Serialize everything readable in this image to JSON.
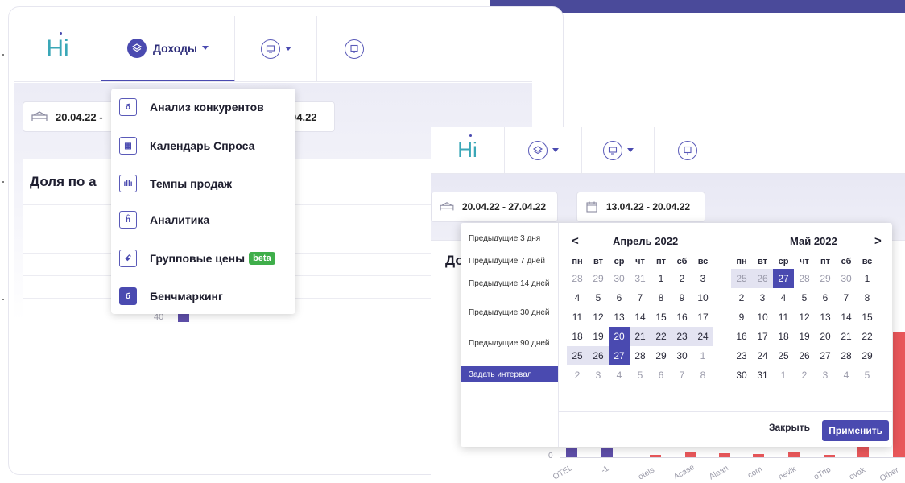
{
  "colors": {
    "accent": "#4a4ab0",
    "brand_teal": "#3aa7b7",
    "bar_purple": "#5e4ea8",
    "bar_red": "#e8575a",
    "beta_green": "#3fae4a"
  },
  "logo": {
    "text": "Hi"
  },
  "left_screen": {
    "nav": {
      "revenue_label": "Доходы"
    },
    "date_range": "20.04.22 -",
    "compare_range_tail": "04.22",
    "card_title": "Доля по а",
    "axis_tick": "40",
    "menu": [
      {
        "label": "Анализ конкурентов",
        "icon": "building-icon",
        "icon_glyph": "б",
        "filled": false
      },
      {
        "label": "Календарь Спроса",
        "icon": "calendar-grid-icon",
        "icon_glyph": "▦",
        "filled": false
      },
      {
        "label": "Темпы продаж",
        "icon": "bar-chart-icon",
        "icon_glyph": "ıllı",
        "filled": false
      },
      {
        "label": "Аналитика",
        "icon": "house-icon",
        "icon_glyph": "ĥ",
        "filled": false
      },
      {
        "label": "Групповые цены",
        "icon": "people-icon",
        "icon_glyph": "ꗃ",
        "filled": false,
        "badge": "beta"
      },
      {
        "label": "Бенчмаркинг",
        "icon": "building-icon",
        "icon_glyph": "б",
        "filled": true
      }
    ]
  },
  "right_screen": {
    "date_range": "20.04.22 - 27.04.22",
    "compare_range": "13.04.22 - 20.04.22",
    "card_title": "До",
    "axis_tick": "0",
    "x_labels": [
      "OTEL",
      "-1",
      "otels",
      "Acase",
      "Alean",
      "com",
      "nevik",
      "oTrip",
      "ovok",
      "Other"
    ],
    "picker": {
      "presets": [
        {
          "label": "Предыдущие 3 дня",
          "active": false
        },
        {
          "label": "Предыдущие 7 дней",
          "active": false
        },
        {
          "label": "Предыдущие 14 дней",
          "active": false
        },
        {
          "label": "Предыдущие 30 дней",
          "active": false
        },
        {
          "label": "Предыдущие 90 дней",
          "active": false
        },
        {
          "label": "Задать интервал",
          "active": true
        }
      ],
      "prev_arrow": "<",
      "next_arrow": ">",
      "weekdays": [
        "пн",
        "вт",
        "ср",
        "чт",
        "пт",
        "сб",
        "вс"
      ],
      "months": [
        {
          "title": "Апрель 2022",
          "weeks": [
            [
              {
                "d": "28",
                "s": "m"
              },
              {
                "d": "29",
                "s": "m"
              },
              {
                "d": "30",
                "s": "m"
              },
              {
                "d": "31",
                "s": "m"
              },
              {
                "d": "1"
              },
              {
                "d": "2"
              },
              {
                "d": "3"
              }
            ],
            [
              {
                "d": "4"
              },
              {
                "d": "5"
              },
              {
                "d": "6"
              },
              {
                "d": "7"
              },
              {
                "d": "8"
              },
              {
                "d": "9"
              },
              {
                "d": "10"
              }
            ],
            [
              {
                "d": "11"
              },
              {
                "d": "12"
              },
              {
                "d": "13"
              },
              {
                "d": "14"
              },
              {
                "d": "15"
              },
              {
                "d": "16"
              },
              {
                "d": "17"
              }
            ],
            [
              {
                "d": "18"
              },
              {
                "d": "19"
              },
              {
                "d": "20",
                "s": "sel"
              },
              {
                "d": "21",
                "s": "range"
              },
              {
                "d": "22",
                "s": "range"
              },
              {
                "d": "23",
                "s": "range"
              },
              {
                "d": "24",
                "s": "range"
              }
            ],
            [
              {
                "d": "25",
                "s": "range"
              },
              {
                "d": "26",
                "s": "range"
              },
              {
                "d": "27",
                "s": "sel"
              },
              {
                "d": "28"
              },
              {
                "d": "29"
              },
              {
                "d": "30"
              },
              {
                "d": "1",
                "s": "m"
              }
            ],
            [
              {
                "d": "2",
                "s": "m"
              },
              {
                "d": "3",
                "s": "m"
              },
              {
                "d": "4",
                "s": "m"
              },
              {
                "d": "5",
                "s": "m"
              },
              {
                "d": "6",
                "s": "m"
              },
              {
                "d": "7",
                "s": "m"
              },
              {
                "d": "8",
                "s": "m"
              }
            ]
          ]
        },
        {
          "title": "Май 2022",
          "weeks": [
            [
              {
                "d": "25",
                "s": "mrange"
              },
              {
                "d": "26",
                "s": "mrange"
              },
              {
                "d": "27",
                "s": "sel"
              },
              {
                "d": "28",
                "s": "m"
              },
              {
                "d": "29",
                "s": "m"
              },
              {
                "d": "30",
                "s": "m"
              },
              {
                "d": "1"
              }
            ],
            [
              {
                "d": "2"
              },
              {
                "d": "3"
              },
              {
                "d": "4"
              },
              {
                "d": "5"
              },
              {
                "d": "6"
              },
              {
                "d": "7"
              },
              {
                "d": "8"
              }
            ],
            [
              {
                "d": "9"
              },
              {
                "d": "10"
              },
              {
                "d": "11"
              },
              {
                "d": "12"
              },
              {
                "d": "13"
              },
              {
                "d": "14"
              },
              {
                "d": "15"
              }
            ],
            [
              {
                "d": "16"
              },
              {
                "d": "17"
              },
              {
                "d": "18"
              },
              {
                "d": "19"
              },
              {
                "d": "20"
              },
              {
                "d": "21"
              },
              {
                "d": "22"
              }
            ],
            [
              {
                "d": "23"
              },
              {
                "d": "24"
              },
              {
                "d": "25"
              },
              {
                "d": "26"
              },
              {
                "d": "27"
              },
              {
                "d": "28"
              },
              {
                "d": "29"
              }
            ],
            [
              {
                "d": "30"
              },
              {
                "d": "31"
              },
              {
                "d": "1",
                "s": "m"
              },
              {
                "d": "2",
                "s": "m"
              },
              {
                "d": "3",
                "s": "m"
              },
              {
                "d": "4",
                "s": "m"
              },
              {
                "d": "5",
                "s": "m"
              }
            ]
          ]
        }
      ],
      "close_label": "Закрыть",
      "apply_label": "Применить"
    }
  }
}
